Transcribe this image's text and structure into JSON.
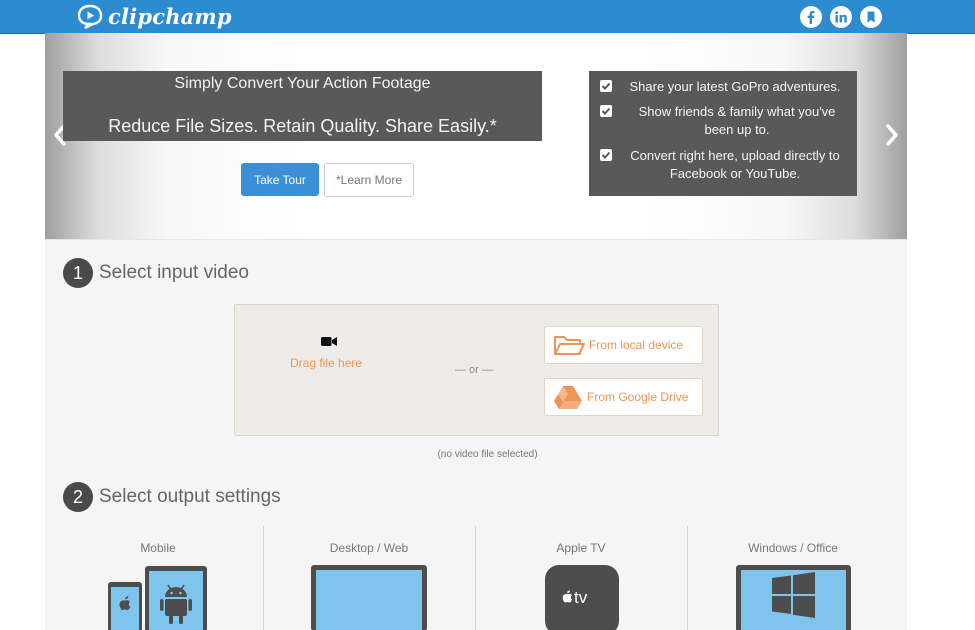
{
  "header": {
    "brand": "clipchamp",
    "icons": [
      "facebook-icon",
      "linkedin-icon",
      "bookmark-icon"
    ]
  },
  "hero": {
    "line1": "Simply Convert Your Action Footage",
    "line2": "Reduce File Sizes. Retain Quality. Share Easily.*",
    "take_tour": "Take Tour",
    "learn_more": "*Learn More",
    "features": [
      "Share your latest GoPro adventures.",
      "Show friends & family what you've been up to.",
      "Convert right here, upload directly to Facebook or YouTube."
    ]
  },
  "step1": {
    "number": "1",
    "title": "Select input video",
    "drag": "Drag file here",
    "or": "— or —",
    "local": "From local device",
    "drive": "From Google Drive",
    "status": "(no video file selected)"
  },
  "step2": {
    "number": "2",
    "title": "Select output settings",
    "options": [
      {
        "label": "Mobile"
      },
      {
        "label": "Desktop / Web"
      },
      {
        "label": "Apple TV",
        "badge": "tv"
      },
      {
        "label": "Windows / Office"
      }
    ]
  },
  "colors": {
    "brand_blue": "#2d8bd0",
    "accent_orange": "#ee9556",
    "dark_box": "#595959"
  }
}
